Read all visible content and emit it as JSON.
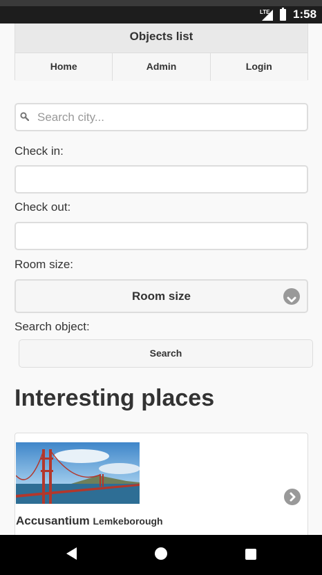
{
  "status_bar": {
    "network": "LTE",
    "time": "1:58"
  },
  "header": {
    "title": "Objects list",
    "tabs": [
      {
        "label": "Home"
      },
      {
        "label": "Admin"
      },
      {
        "label": "Login"
      }
    ]
  },
  "form": {
    "search_placeholder": "Search city...",
    "check_in_label": "Check in:",
    "check_out_label": "Check out:",
    "room_size_label": "Room size:",
    "room_size_value": "Room size",
    "search_object_label": "Search object:",
    "search_button": "Search"
  },
  "places": {
    "heading": "Interesting places",
    "items": [
      {
        "name": "Accusantium",
        "city": "Lemkeborough"
      }
    ]
  }
}
